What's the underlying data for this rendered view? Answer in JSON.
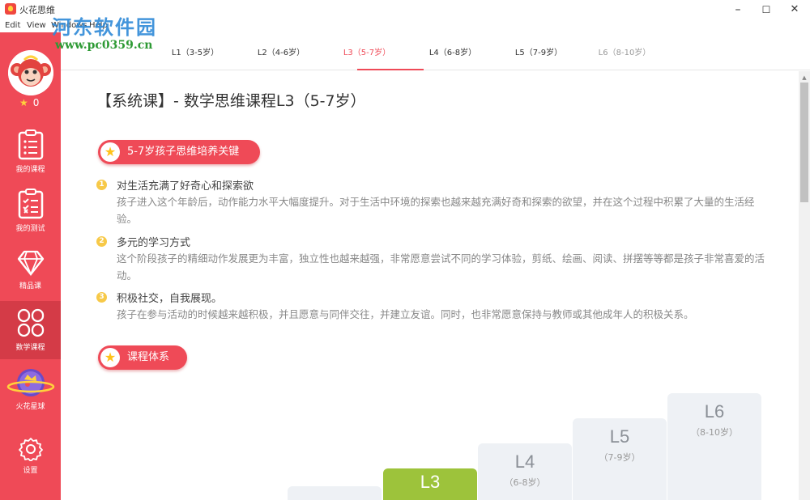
{
  "window": {
    "title": "火花思维",
    "minimize": "–",
    "maximize": "☐",
    "close": "✕"
  },
  "menu": [
    "Edit",
    "View",
    "Windows",
    "Help"
  ],
  "watermark": {
    "title": "河东软件园",
    "url": "www.pc0359.cn"
  },
  "sidebar": {
    "star_count": "0",
    "items": [
      {
        "label": "我的课程",
        "icon": "clipboard-list-icon"
      },
      {
        "label": "我的测试",
        "icon": "checklist-icon"
      },
      {
        "label": "精品课",
        "icon": "diamond-icon"
      },
      {
        "label": "数学课程",
        "icon": "four-petal-icon",
        "active": true
      },
      {
        "label": "火花星球",
        "icon": "planet-icon"
      },
      {
        "label": "设置",
        "icon": "gear-icon"
      }
    ]
  },
  "tabs": [
    {
      "label": "L1（3-5岁）"
    },
    {
      "label": "L2（4-6岁）"
    },
    {
      "label": "L3（5-7岁）",
      "active": true
    },
    {
      "label": "L4（6-8岁）"
    },
    {
      "label": "L5（7-9岁）"
    },
    {
      "label": "L6（8-10岁）",
      "disabled": true
    }
  ],
  "page": {
    "title": "【系统课】- 数学思维课程L3（5-7岁）",
    "section1_title": "5-7岁孩子思维培养关键",
    "section2_title": "课程体系",
    "points": [
      {
        "num": "1",
        "title": "对生活充满了好奇心和探索欲",
        "body": "孩子进入这个年龄后，动作能力水平大幅度提升。对于生活中环境的探索也越来越充满好奇和探索的欲望，并在这个过程中积累了大量的生活经验。"
      },
      {
        "num": "2",
        "title": "多元的学习方式",
        "body": "这个阶段孩子的精细动作发展更为丰富，独立性也越来越强，非常愿意尝试不同的学习体验，剪纸、绘画、阅读、拼摆等等都是孩子非常喜爱的活动。"
      },
      {
        "num": "3",
        "title": "积极社交，自我展现。",
        "body": "孩子在参与活动的时候越来越积极，并且愿意与同伴交往，并建立友谊。同时，也非常愿意保持与教师或其他成年人的积极关系。"
      }
    ],
    "levels": [
      {
        "level": "L3",
        "age": "",
        "active": true
      },
      {
        "level": "L4",
        "age": "（6-8岁）"
      },
      {
        "level": "L5",
        "age": "（7-9岁）"
      },
      {
        "level": "L6",
        "age": "（8-10岁）"
      }
    ]
  },
  "colors": {
    "accent": "#ef4a57",
    "sidebar_active": "#d43b47",
    "level_active": "#9dc33b",
    "level_inactive": "#eef1f5"
  }
}
